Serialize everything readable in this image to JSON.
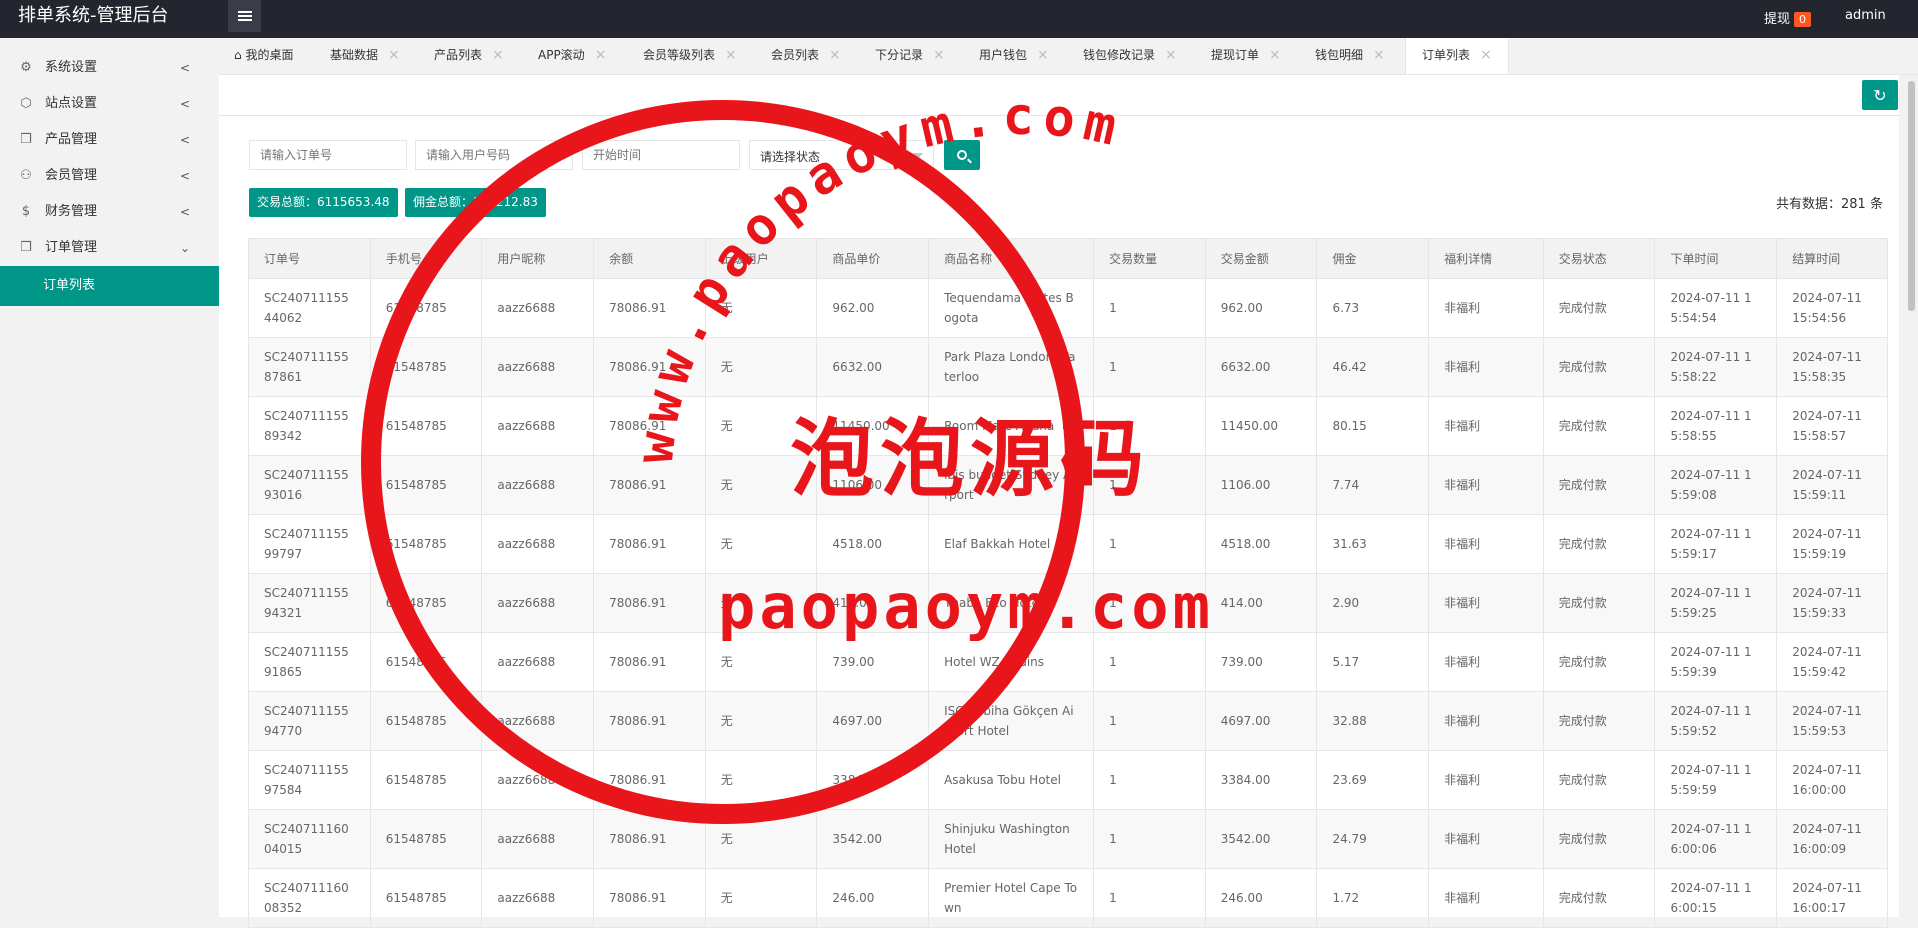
{
  "app": {
    "title": "排单系统-管理后台"
  },
  "topbar": {
    "withdraw_label": "提现",
    "withdraw_count": "0",
    "user": "admin"
  },
  "sidebar": {
    "items": [
      {
        "label": "系统设置",
        "icon": "gear-icon"
      },
      {
        "label": "站点设置",
        "icon": "cube-icon"
      },
      {
        "label": "产品管理",
        "icon": "box-icon"
      },
      {
        "label": "会员管理",
        "icon": "user-icon"
      },
      {
        "label": "财务管理",
        "icon": "dollar-icon"
      },
      {
        "label": "订单管理",
        "icon": "box-icon"
      }
    ],
    "sub_active": "订单列表"
  },
  "tabs": [
    {
      "label": "我的桌面"
    },
    {
      "label": "基础数据"
    },
    {
      "label": "产品列表"
    },
    {
      "label": "APP滚动"
    },
    {
      "label": "会员等级列表"
    },
    {
      "label": "会员列表"
    },
    {
      "label": "下分记录"
    },
    {
      "label": "用户钱包"
    },
    {
      "label": "钱包修改记录"
    },
    {
      "label": "提现订单"
    },
    {
      "label": "钱包明细"
    },
    {
      "label": "订单列表"
    }
  ],
  "filters": {
    "order_placeholder": "请输入订单号",
    "phone_placeholder": "请输入用户号码",
    "start_placeholder": "开始时间",
    "status_value": "请选择状态"
  },
  "stats": {
    "trade_total": "交易总额：6115653.48",
    "commission_total": "佣金总额：188212.83",
    "count": "共有数据：281 条"
  },
  "table": {
    "headers": [
      "订单号",
      "手机号",
      "用户昵称",
      "余额",
      "上级用户",
      "商品单价",
      "商品名称",
      "交易数量",
      "交易金额",
      "佣金",
      "福利详情",
      "交易状态",
      "下单时间",
      "结算时间"
    ],
    "rows": [
      [
        "SC24071115544062",
        "61548785",
        "aazz6688",
        "78086.91",
        "无",
        "962.00",
        "Tequendama Suites Bogota",
        "1",
        "962.00",
        "6.73",
        "非福利",
        "完成付款",
        "2024-07-11 15:54:54",
        "2024-07-11 15:54:56"
      ],
      [
        "SC24071115587861",
        "61548785",
        "aazz6688",
        "78086.91",
        "无",
        "6632.00",
        "Park Plaza London Waterloo",
        "1",
        "6632.00",
        "46.42",
        "非福利",
        "完成付款",
        "2024-07-11 15:58:22",
        "2024-07-11 15:58:35"
      ],
      [
        "SC24071115589342",
        "61548785",
        "aazz6688",
        "78086.91",
        "无",
        "11450.00",
        "Room Mate Aitana",
        "1",
        "11450.00",
        "80.15",
        "非福利",
        "完成付款",
        "2024-07-11 15:58:55",
        "2024-07-11 15:58:57"
      ],
      [
        "SC24071115593016",
        "61548785",
        "aazz6688",
        "78086.91",
        "无",
        "1106.00",
        "ibis budget Sydney Airport",
        "1",
        "1106.00",
        "7.74",
        "非福利",
        "完成付款",
        "2024-07-11 15:59:08",
        "2024-07-11 15:59:11"
      ],
      [
        "SC24071115599797",
        "61548785",
        "aazz6688",
        "78086.91",
        "无",
        "4518.00",
        "Elaf Bakkah Hotel",
        "1",
        "4518.00",
        "31.63",
        "非福利",
        "完成付款",
        "2024-07-11 15:59:17",
        "2024-07-11 15:59:19"
      ],
      [
        "SC24071115594321",
        "61548785",
        "aazz6688",
        "78086.91",
        "无",
        "414.00",
        "Thaba Eco Hotel",
        "1",
        "414.00",
        "2.90",
        "非福利",
        "完成付款",
        "2024-07-11 15:59:25",
        "2024-07-11 15:59:33"
      ],
      [
        "SC24071115591865",
        "61548785",
        "aazz6688",
        "78086.91",
        "无",
        "739.00",
        "Hotel WZ Jardins",
        "1",
        "739.00",
        "5.17",
        "非福利",
        "完成付款",
        "2024-07-11 15:59:39",
        "2024-07-11 15:59:42"
      ],
      [
        "SC24071115594770",
        "61548785",
        "aazz6688",
        "78086.91",
        "无",
        "4697.00",
        "ISG Sabiha Gökçen Airport Hotel",
        "1",
        "4697.00",
        "32.88",
        "非福利",
        "完成付款",
        "2024-07-11 15:59:52",
        "2024-07-11 15:59:53"
      ],
      [
        "SC24071115597584",
        "61548785",
        "aazz6688",
        "78086.91",
        "无",
        "3384.00",
        "Asakusa Tobu Hotel",
        "1",
        "3384.00",
        "23.69",
        "非福利",
        "完成付款",
        "2024-07-11 15:59:59",
        "2024-07-11 16:00:00"
      ],
      [
        "SC24071116004015",
        "61548785",
        "aazz6688",
        "78086.91",
        "无",
        "3542.00",
        "Shinjuku Washington Hotel",
        "1",
        "3542.00",
        "24.79",
        "非福利",
        "完成付款",
        "2024-07-11 16:00:06",
        "2024-07-11 16:00:09"
      ],
      [
        "SC24071116008352",
        "61548785",
        "aazz6688",
        "78086.91",
        "无",
        "246.00",
        "Premier Hotel Cape Town",
        "1",
        "246.00",
        "1.72",
        "非福利",
        "完成付款",
        "2024-07-11 16:00:15",
        "2024-07-11 16:00:17"
      ]
    ]
  },
  "watermark": {
    "top": "www.paopaoym.com",
    "center": "泡泡源码",
    "bottom": "paopaoym.com",
    "color": "#e8161b"
  }
}
